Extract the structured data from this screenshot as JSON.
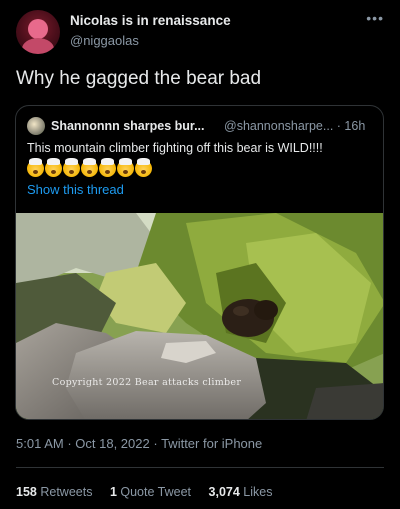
{
  "tweet": {
    "display_name": "Nicolas is in renaissance",
    "handle": "@niggaolas",
    "more_icon": "more-horizontal-icon",
    "text": "Why he gagged the bear bad",
    "timestamp": "5:01 AM",
    "date": "Oct 18, 2022",
    "source": "Twitter for iPhone",
    "stats": {
      "retweets_count": "158",
      "retweets_label": "Retweets",
      "quotes_count": "1",
      "quotes_label": "Quote Tweet",
      "likes_count": "3,074",
      "likes_label": "Likes"
    }
  },
  "quoted_tweet": {
    "display_name": "Shannonnn sharpes bur...",
    "handle": "@shannonsharpe...",
    "time": "16h",
    "text": "This mountain climber fighting off this bear is WILD!!!!",
    "emoji_icon": "exploding-head-emoji",
    "emoji_count": 7,
    "thread_link": "Show this thread",
    "media_watermark": "Copyright 2022 Bear attacks climber"
  }
}
